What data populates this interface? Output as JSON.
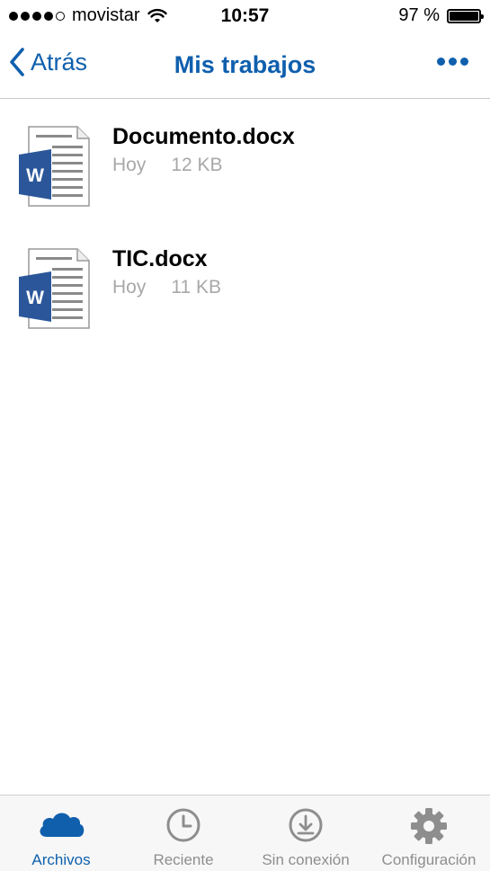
{
  "status_bar": {
    "carrier": "movistar",
    "time": "10:57",
    "battery": "97 %",
    "battery_level": 0.97
  },
  "nav": {
    "back_label": "Atrás",
    "title": "Mis trabajos",
    "more_icon": "ellipsis-icon"
  },
  "files": [
    {
      "name": "Documento.docx",
      "date": "Hoy",
      "size": "12 KB",
      "icon": "word-document-icon"
    },
    {
      "name": "TIC.docx",
      "date": "Hoy",
      "size": "11 KB",
      "icon": "word-document-icon"
    }
  ],
  "tabs": [
    {
      "label": "Archivos",
      "icon": "cloud-icon",
      "active": true
    },
    {
      "label": "Reciente",
      "icon": "clock-icon",
      "active": false
    },
    {
      "label": "Sin conexión",
      "icon": "download-circle-icon",
      "active": false
    },
    {
      "label": "Configuración",
      "icon": "gear-icon",
      "active": false
    }
  ],
  "colors": {
    "accent": "#0f5fad",
    "word_blue": "#2b579a",
    "inactive_tab": "#8e8e8e",
    "meta_text": "#a8a8a8"
  }
}
